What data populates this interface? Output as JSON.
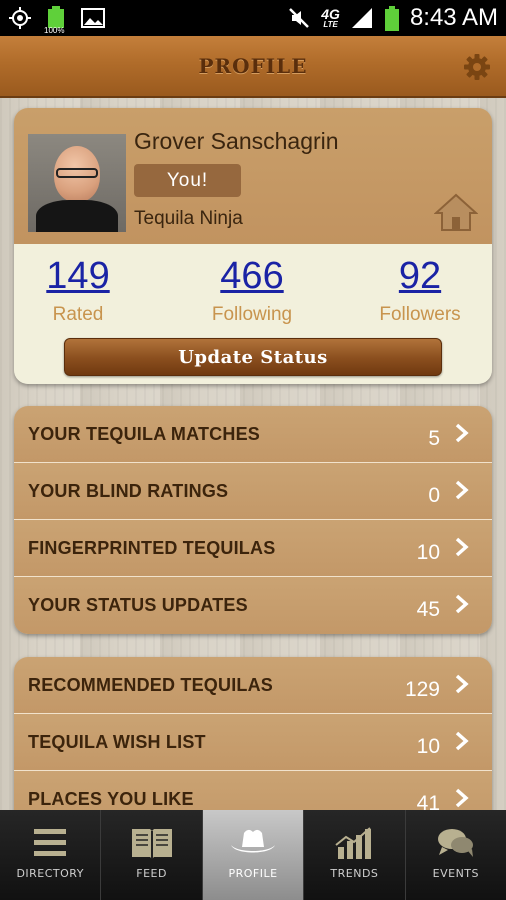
{
  "status_bar": {
    "battery_percent": "100%",
    "network": "4G",
    "network_sub": "LTE",
    "time": "8:43 AM",
    "icons": [
      "gps-icon",
      "battery-icon",
      "image-icon",
      "mute-icon",
      "signal-icon"
    ]
  },
  "header": {
    "title": "PROFILE",
    "settings_icon": "gear-icon"
  },
  "profile": {
    "name": "Grover Sanschagrin",
    "badge": "You!",
    "rank": "Tequila Ninja",
    "home_icon": "home-icon",
    "stats": [
      {
        "value": "149",
        "label": "Rated"
      },
      {
        "value": "466",
        "label": "Following"
      },
      {
        "value": "92",
        "label": "Followers"
      }
    ],
    "update_button": "Update Status"
  },
  "groups": [
    {
      "items": [
        {
          "label": "YOUR TEQUILA MATCHES",
          "count": "5"
        },
        {
          "label": "YOUR BLIND RATINGS",
          "count": "0"
        },
        {
          "label": "FINGERPRINTED TEQUILAS",
          "count": "10"
        },
        {
          "label": "YOUR STATUS UPDATES",
          "count": "45"
        }
      ]
    },
    {
      "items": [
        {
          "label": "RECOMMENDED TEQUILAS",
          "count": "129"
        },
        {
          "label": "TEQUILA WISH LIST",
          "count": "10"
        },
        {
          "label": "PLACES YOU LIKE",
          "count": "41"
        }
      ]
    }
  ],
  "tabs": [
    {
      "label": "DIRECTORY",
      "icon": "list-icon",
      "active": false
    },
    {
      "label": "FEED",
      "icon": "book-icon",
      "active": false
    },
    {
      "label": "PROFILE",
      "icon": "cowboy-hat-icon",
      "active": true
    },
    {
      "label": "TRENDS",
      "icon": "bar-chart-icon",
      "active": false
    },
    {
      "label": "EVENTS",
      "icon": "chat-bubbles-icon",
      "active": false
    }
  ],
  "colors": {
    "header_wood": "#b06c2a",
    "card_tan": "#c39868",
    "stat_number": "#1a23a5",
    "stat_label": "#c8944e",
    "battery_green": "#5fd03a"
  }
}
